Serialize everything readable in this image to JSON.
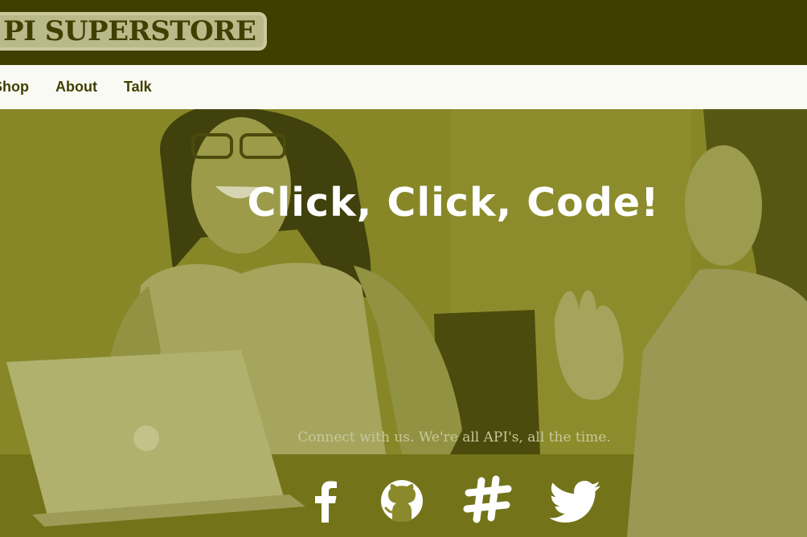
{
  "header": {
    "logo_text": "PI SUPERSTORE",
    "background_color": "#3f4000"
  },
  "nav": {
    "items": [
      {
        "label": "Shop"
      },
      {
        "label": "About"
      },
      {
        "label": "Talk"
      }
    ]
  },
  "hero": {
    "title": "Click, Click, Code!",
    "tagline": "Connect with us. We're all API's, all the time.",
    "overlay_color": "#8a8a2a"
  },
  "social": [
    {
      "icon": "facebook-icon"
    },
    {
      "icon": "github-icon"
    },
    {
      "icon": "slack-icon"
    },
    {
      "icon": "twitter-icon"
    }
  ]
}
